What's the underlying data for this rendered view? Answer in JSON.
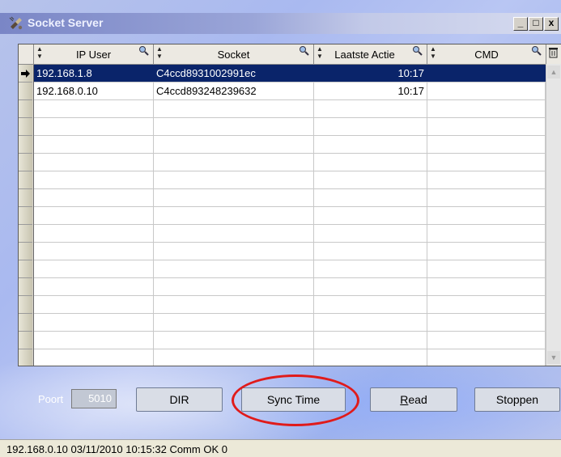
{
  "window": {
    "title": "Socket Server"
  },
  "title_controls": {
    "minimize": "_",
    "maximize": "□",
    "close": "x"
  },
  "grid": {
    "columns": [
      "IP User",
      "Socket",
      "Laatste Actie",
      "CMD"
    ],
    "rows": [
      {
        "ip": "192.168.1.8",
        "socket": "C4ccd8931002991ec",
        "laatste_actie": "10:17",
        "cmd": "",
        "selected": true
      },
      {
        "ip": "192.168.0.10",
        "socket": "C4ccd893248239632",
        "laatste_actie": "10:17",
        "cmd": "",
        "selected": false
      }
    ],
    "empty_rows": 15
  },
  "controls": {
    "port_label": "Poort",
    "port_value": "5010",
    "dir_button": "DIR",
    "sync_time_button": "Sync Time",
    "read_button_prefix": "",
    "read_button_mnemonic": "R",
    "read_button_rest": "ead",
    "stop_button": "Stoppen"
  },
  "status_bar": {
    "text": "192.168.0.10 03/11/2010 10:15:32 Comm OK 0"
  },
  "colors": {
    "selection": "#0a246a",
    "annotation_circle": "#e01b1b"
  }
}
